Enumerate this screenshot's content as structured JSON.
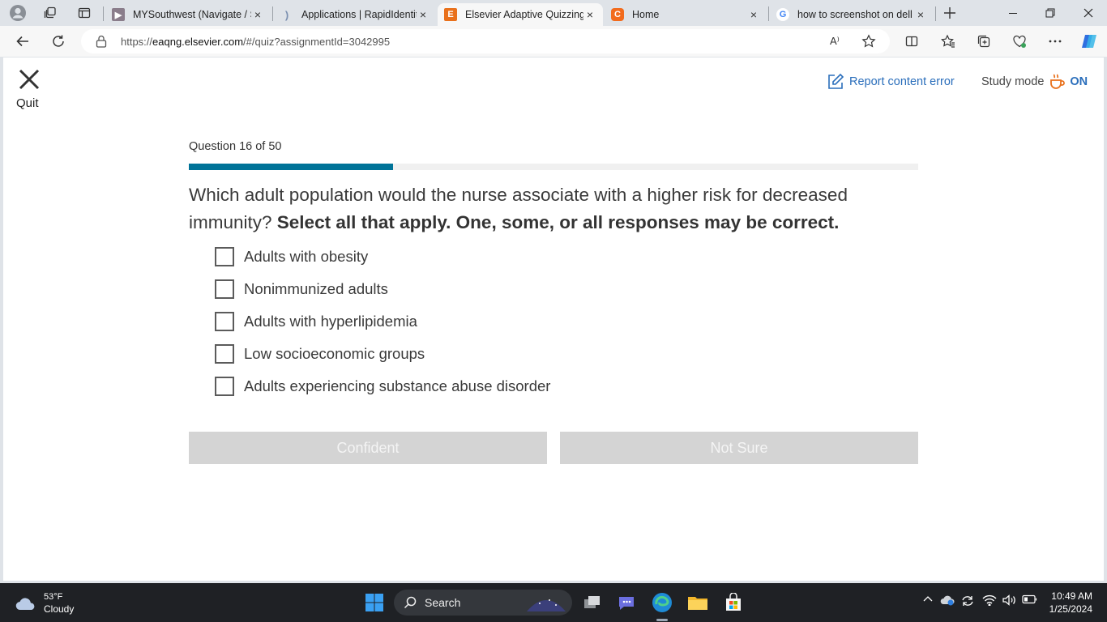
{
  "browser": {
    "tabs": [
      {
        "title": "MYSouthwest (Navigate / S",
        "close": "×"
      },
      {
        "title": "Applications | RapidIdentit",
        "close": "×"
      },
      {
        "title": "Elsevier Adaptive Quizzing",
        "close": "×",
        "favicon_letter": "E"
      },
      {
        "title": "Home",
        "close": "×",
        "favicon_letter": "C"
      },
      {
        "title": "how to screenshot on dell",
        "close": "×",
        "favicon_letter": "G"
      }
    ],
    "url_prefix": "https://",
    "url_host": "eaqng.elsevier.com",
    "url_path": "/#/quiz?assignmentId=3042995",
    "read_aloud_label": "A⁾"
  },
  "header": {
    "quit_label": "Quit",
    "report_label": "Report content error",
    "study_mode_label": "Study mode",
    "study_mode_state": "ON"
  },
  "quiz": {
    "counter": "Question 16 of 50",
    "progress_fraction": 0.28,
    "question_text": "Which adult population would the nurse associate with a higher risk for decreased immunity? ",
    "question_instruction": "Select all that apply. One, some, or all responses may be correct.",
    "choices": [
      "Adults with obesity",
      "Nonimmunized adults",
      "Adults with hyperlipidemia",
      "Low socioeconomic groups",
      "Adults experiencing substance abuse disorder"
    ],
    "confident_label": "Confident",
    "not_sure_label": "Not Sure"
  },
  "taskbar": {
    "temperature": "53°F",
    "condition": "Cloudy",
    "search_label": "Search",
    "time": "10:49 AM",
    "date": "1/25/2024"
  },
  "colors": {
    "accent": "#007398",
    "link": "#2a6ebb",
    "study_icon": "#e9711c",
    "button_disabled": "#d4d4d4"
  }
}
